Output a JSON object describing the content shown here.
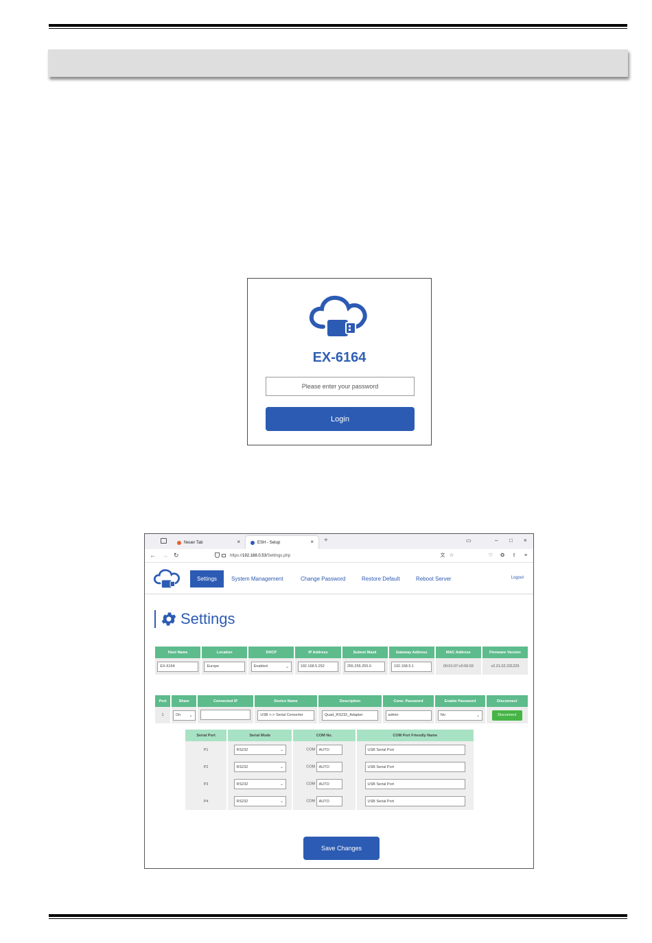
{
  "login": {
    "title": "EX-6164",
    "password_placeholder": "Please enter your password",
    "login_button": "Login"
  },
  "browser": {
    "tabs": [
      {
        "label": "Neuer Tab"
      },
      {
        "label": "ESH - Setup"
      }
    ],
    "url_prefix": "https://",
    "url_host": "192.168.0.53",
    "url_path": "/Settings.php"
  },
  "app": {
    "menu": [
      {
        "label": "Settings"
      },
      {
        "label": "System Management"
      },
      {
        "label": "Change Password"
      },
      {
        "label": "Restore Default"
      },
      {
        "label": "Reboot Server"
      }
    ],
    "logout": "Logout",
    "page_title": "Settings",
    "accent_color": "#2c5bb3",
    "header_green": "#5dbb8c",
    "host_table": {
      "headers": [
        "Host Name",
        "Location",
        "DHCP",
        "IP Address",
        "Subnet Mask",
        "Gateway Address",
        "MAC Address",
        "Firmware Version"
      ],
      "host_name": "EX-6164",
      "location": "Europe",
      "dhcp": "Enabled",
      "ip_address": "192.168.5.252",
      "subnet_mask": "255.255.255.0",
      "gateway": "192.168.5.1",
      "mac": "00:01:07:c0:00:03",
      "firmware": "v2.21.02.231229"
    },
    "port_table": {
      "headers": [
        "Port",
        "Share",
        "Connected IP",
        "Device Name",
        "Description",
        "Conn. Password",
        "Enable Password",
        "Disconnect"
      ],
      "port": "1",
      "share": "On",
      "connected_ip": "",
      "device_name": "USB <-> Serial Converter",
      "description": "Quad_RS232_Adapter",
      "conn_password": "admin",
      "enable_password": "No",
      "disconnect": "Disconnect"
    },
    "serial_table": {
      "headers": [
        "Serial Port",
        "Serial Mode",
        "COM No.",
        "COM Port Friendly Name"
      ],
      "com_label": "COM",
      "rows": [
        {
          "port": "P1",
          "mode": "RS232",
          "com": "AUTO",
          "name": "USB Serial Port"
        },
        {
          "port": "P2",
          "mode": "RS232",
          "com": "AUTO",
          "name": "USB Serial Port"
        },
        {
          "port": "P3",
          "mode": "RS232",
          "com": "AUTO",
          "name": "USB Serial Port"
        },
        {
          "port": "P4",
          "mode": "RS232",
          "com": "AUTO",
          "name": "USB Serial Port"
        }
      ]
    },
    "save_button": "Save Changes"
  }
}
